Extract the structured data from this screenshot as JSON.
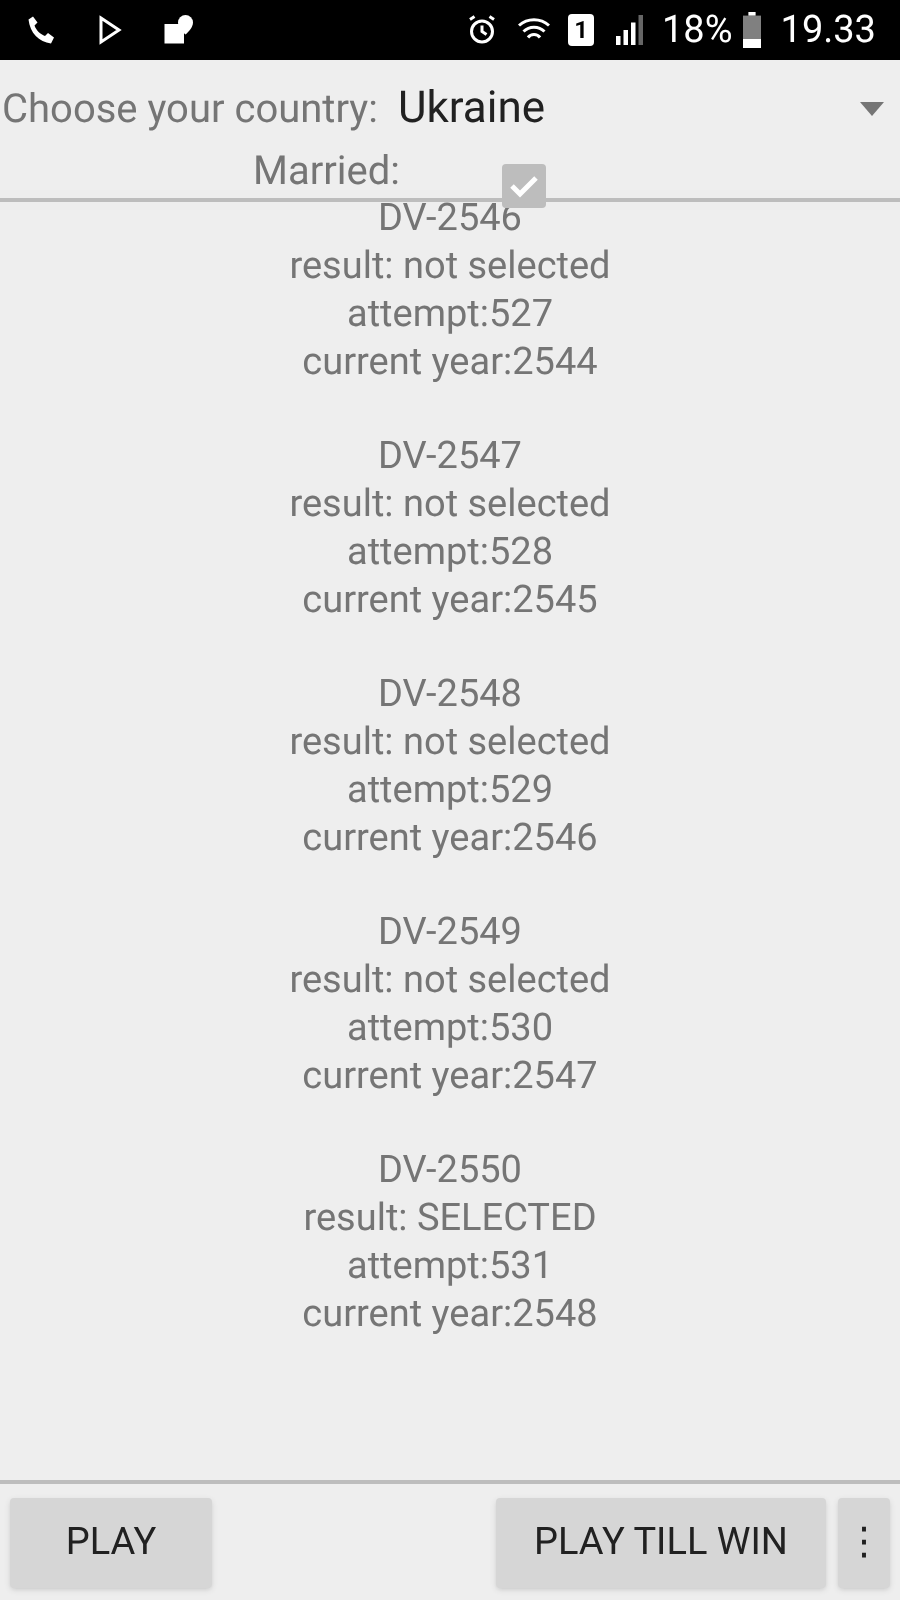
{
  "status_bar": {
    "sim_slot": "1",
    "battery": "18%",
    "time": "19.33"
  },
  "form": {
    "country_label": "Choose your country:",
    "country": "Ukraine",
    "married_label": "Married:",
    "married_checked": true
  },
  "results": [
    {
      "title": "DV-2546",
      "result": "result: not selected",
      "attempt": "attempt:527",
      "year": "current year:2544"
    },
    {
      "title": "DV-2547",
      "result": "result: not selected",
      "attempt": "attempt:528",
      "year": "current year:2545"
    },
    {
      "title": "DV-2548",
      "result": "result: not selected",
      "attempt": "attempt:529",
      "year": "current year:2546"
    },
    {
      "title": "DV-2549",
      "result": "result: not selected",
      "attempt": "attempt:530",
      "year": "current year:2547"
    },
    {
      "title": "DV-2550",
      "result": "result: SELECTED",
      "attempt": "attempt:531",
      "year": "current year:2548"
    }
  ],
  "buttons": {
    "play": "PLAY",
    "play_till_win": "PLAY TILL WIN",
    "more": "⋮"
  }
}
